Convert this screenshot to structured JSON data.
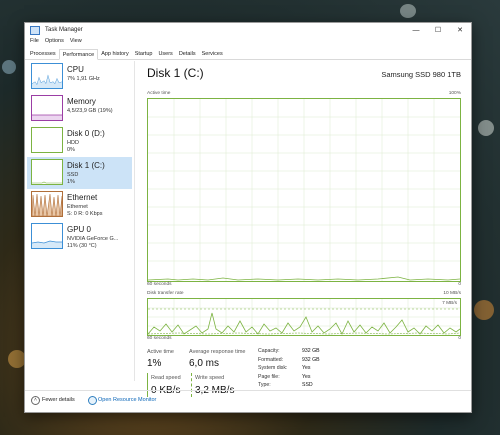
{
  "window": {
    "title": "Task Manager"
  },
  "menu": [
    "File",
    "Options",
    "View"
  ],
  "tabs": [
    {
      "label": "Processes",
      "active": false
    },
    {
      "label": "Performance",
      "active": true
    },
    {
      "label": "App history",
      "active": false
    },
    {
      "label": "Startup",
      "active": false
    },
    {
      "label": "Users",
      "active": false
    },
    {
      "label": "Details",
      "active": false
    },
    {
      "label": "Services",
      "active": false
    }
  ],
  "sidebar": [
    {
      "name": "CPU",
      "line1": "7% 1,91 GHz",
      "line2": "",
      "color": "#3c8fd6"
    },
    {
      "name": "Memory",
      "line1": "4,5/23,9 GB (19%)",
      "line2": "",
      "color": "#9b3ea5"
    },
    {
      "name": "Disk 0 (D:)",
      "line1": "HDD",
      "line2": "0%",
      "color": "#7cb342"
    },
    {
      "name": "Disk 1 (C:)",
      "line1": "SSD",
      "line2": "1%",
      "color": "#7cb342",
      "selected": true
    },
    {
      "name": "Ethernet",
      "line1": "Ethernet",
      "line2": "S: 0 R: 0 Kbps",
      "color": "#b06f3a"
    },
    {
      "name": "GPU 0",
      "line1": "NVIDIA GeForce G...",
      "line2": "11% (30 °C)",
      "color": "#3c8fd6"
    }
  ],
  "main": {
    "title": "Disk 1 (C:)",
    "device": "Samsung SSD 980 1TB",
    "active_time_chart": {
      "label_left": "Active time",
      "label_right": "100%",
      "bottom_left": "60 seconds",
      "bottom_right": "0"
    },
    "transfer_chart": {
      "label_left": "Disk transfer rate",
      "label_right": "10 MB/s",
      "inner_label": "7 MB/s",
      "bottom_left": "60 seconds",
      "bottom_right": "0"
    },
    "stats": {
      "active_time_label": "Active time",
      "active_time_value": "1%",
      "response_label": "Average response time",
      "response_value": "6,0 ms",
      "read_label": "Read speed",
      "read_value": "0 KB/s",
      "write_label": "Write speed",
      "write_value": "3,2 MB/s"
    },
    "props": [
      {
        "k": "Capacity:",
        "v": "932 GB"
      },
      {
        "k": "Formatted:",
        "v": "932 GB"
      },
      {
        "k": "System disk:",
        "v": "Yes"
      },
      {
        "k": "Page file:",
        "v": "Yes"
      },
      {
        "k": "Type:",
        "v": "SSD"
      }
    ]
  },
  "footer": {
    "fewer_details": "Fewer details",
    "resource_monitor": "Open Resource Monitor"
  },
  "colors": {
    "disk_green": "#7cb342",
    "selection": "#cce3f7",
    "link": "#0b66b8"
  }
}
